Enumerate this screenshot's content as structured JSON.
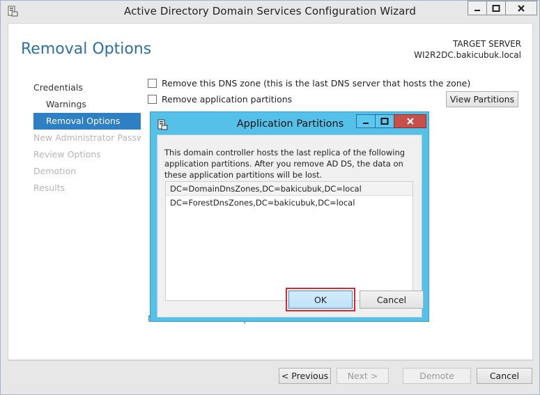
{
  "window": {
    "title": "Active Directory Domain Services Configuration Wizard"
  },
  "page": {
    "title": "Removal Options",
    "target_server_label": "TARGET SERVER",
    "target_server_name": "WI2R2DC.bakicubuk.local"
  },
  "nav": {
    "items": [
      {
        "label": "Credentials",
        "state": "normal"
      },
      {
        "label": "Warnings",
        "state": "normal"
      },
      {
        "label": "Removal Options",
        "state": "active"
      },
      {
        "label": "New Administrator Passw...",
        "state": "disabled"
      },
      {
        "label": "Review Options",
        "state": "disabled"
      },
      {
        "label": "Demotion",
        "state": "disabled"
      },
      {
        "label": "Results",
        "state": "disabled"
      }
    ]
  },
  "options": {
    "remove_dns_zone": "Remove this DNS zone (this is the last DNS server that hosts the zone)",
    "remove_app_partitions": "Remove application partitions",
    "view_partitions_button": "View Partitions"
  },
  "more_link": "More about removal options",
  "footer": {
    "previous": "< Previous",
    "next": "Next >",
    "demote": "Demote",
    "cancel": "Cancel"
  },
  "dialog": {
    "title": "Application Partitions",
    "message": "This domain controller hosts the last replica of the following application partitions. After you remove AD DS, the data on these application partitions will be lost.",
    "partitions": [
      "DC=DomainDnsZones,DC=bakicubuk,DC=local",
      "DC=ForestDnsZones,DC=bakicubuk,DC=local"
    ],
    "ok": "OK",
    "cancel": "Cancel"
  },
  "colors": {
    "accent": "#2e7fc4",
    "dialog_frame": "#55c0e8",
    "close_button": "#c7504a",
    "highlight": "#d9272e"
  }
}
